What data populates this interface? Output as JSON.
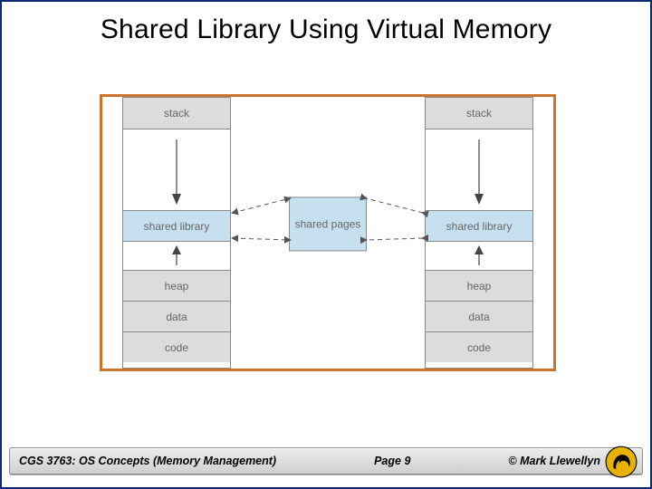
{
  "title": "Shared Library Using Virtual Memory",
  "diagram": {
    "left_col": {
      "stack": "stack",
      "shared_library": "shared library",
      "heap": "heap",
      "data": "data",
      "code": "code"
    },
    "right_col": {
      "stack": "stack",
      "shared_library": "shared library",
      "heap": "heap",
      "data": "data",
      "code": "code"
    },
    "center": "shared\npages"
  },
  "footer": {
    "left": "CGS 3763: OS Concepts  (Memory Management)",
    "center": "Page 9",
    "right": "© Mark Llewellyn"
  }
}
